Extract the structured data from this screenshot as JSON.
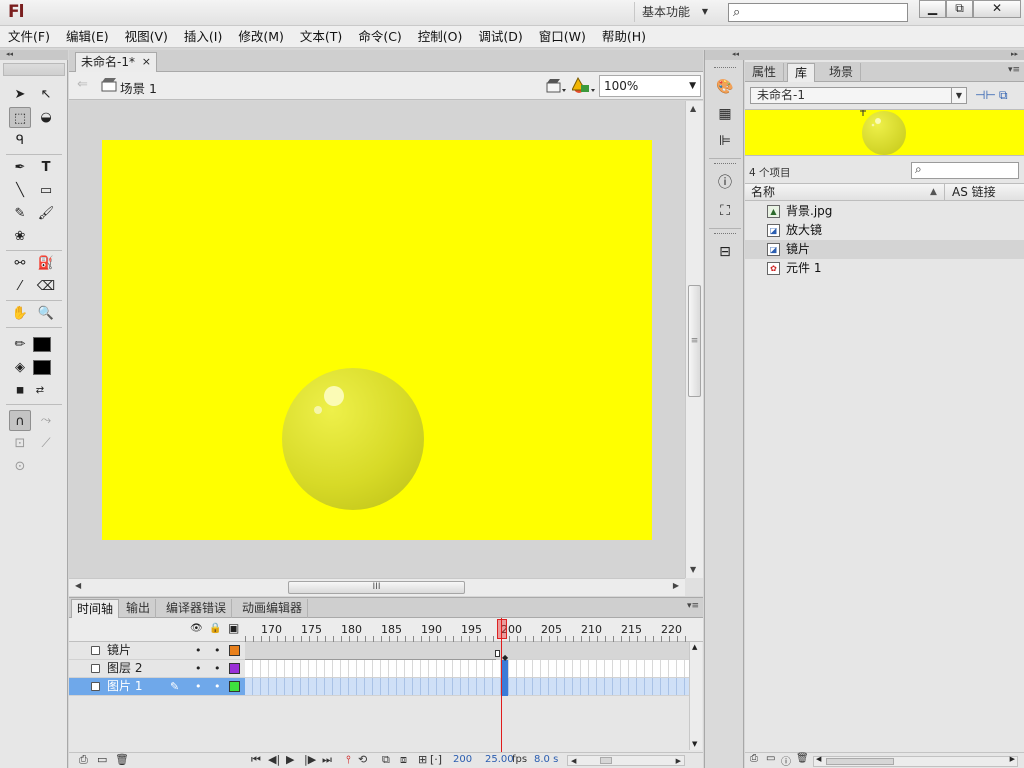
{
  "app": {
    "logo": "Fl",
    "workspace": "基本功能",
    "help_search_placeholder": ""
  },
  "window_buttons": {
    "minimize": "▁",
    "maximize": "⧉",
    "close": "✕"
  },
  "menu": [
    "文件(F)",
    "编辑(E)",
    "视图(V)",
    "插入(I)",
    "修改(M)",
    "文本(T)",
    "命令(C)",
    "控制(O)",
    "调试(D)",
    "窗口(W)",
    "帮助(H)"
  ],
  "document": {
    "tab_title": "未命名-1*",
    "tab_close": "×",
    "scene": "场景 1",
    "zoom": "100%"
  },
  "colors": {
    "stage": "#ffff00",
    "bubble": "#d9dd2a",
    "selected_layer": "#6fa8ea",
    "playhead": "#e01c1c"
  },
  "timeline": {
    "tabs": [
      "时间轴",
      "输出",
      "编译器错误",
      "动画编辑器"
    ],
    "ruler_labels": [
      "170",
      "175",
      "180",
      "185",
      "190",
      "195",
      "200",
      "205",
      "210",
      "215",
      "220"
    ],
    "layers": [
      {
        "name": "镜片",
        "color": "#e8801c",
        "active": false
      },
      {
        "name": "图层 2",
        "color": "#9a2fd8",
        "active": false
      },
      {
        "name": "图片 1",
        "color": "#3ee23e",
        "active": true
      }
    ],
    "current_frame": "200",
    "fps": "25.00",
    "fps_unit": "fps",
    "elapsed": "8.0 s"
  },
  "library": {
    "tabs": [
      "属性",
      "库",
      "场景"
    ],
    "doc_select": "未命名-1",
    "count": "4 个项目",
    "col_name": "名称",
    "col_linkage": "AS 链接",
    "items": [
      {
        "name": "背景.jpg",
        "icon": "bitmap-icon"
      },
      {
        "name": "放大镜",
        "icon": "graphic-symbol-icon"
      },
      {
        "name": "镜片",
        "icon": "graphic-symbol-icon"
      },
      {
        "name": "元件 1",
        "icon": "movieclip-symbol-icon"
      }
    ]
  }
}
